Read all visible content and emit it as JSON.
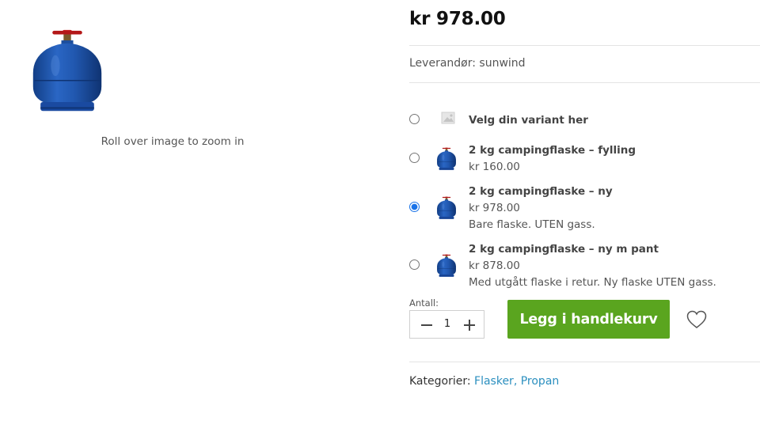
{
  "gallery": {
    "zoom_hint": "Roll over image to zoom in"
  },
  "product": {
    "price": "kr 978.00",
    "supplier": "Leverandør: sunwind"
  },
  "variants": [
    {
      "title": "Velg din variant her",
      "price": "",
      "description": "",
      "selected": false,
      "thumb": "placeholder-image-icon"
    },
    {
      "title": "2 kg campingflaske – fylling",
      "price": "kr 160.00",
      "description": "",
      "selected": false,
      "thumb": "gas-bottle-thumbnail"
    },
    {
      "title": "2 kg campingflaske – ny",
      "price": "kr 978.00",
      "description": "Bare flaske. UTEN gass.",
      "selected": true,
      "thumb": "gas-bottle-thumbnail"
    },
    {
      "title": "2 kg campingflaske – ny m pant",
      "price": "kr 878.00",
      "description": "Med utgått flaske i retur. Ny flaske UTEN gass.",
      "selected": false,
      "thumb": "gas-bottle-thumbnail"
    }
  ],
  "cart": {
    "quantity_label": "Antall:",
    "quantity": "1",
    "add_to_cart_label": "Legg i handlekurv",
    "button_color": "#5aa51f"
  },
  "categories": {
    "label": "Kategorier:",
    "links": [
      "Flasker",
      "Propan"
    ],
    "separator": ", "
  }
}
